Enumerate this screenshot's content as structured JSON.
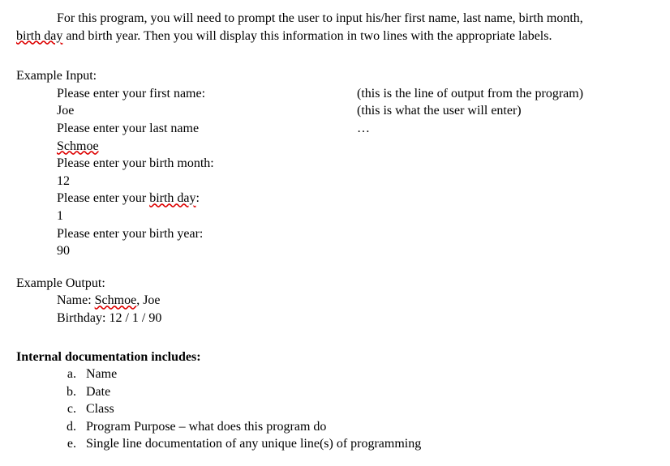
{
  "intro": {
    "line1_indent": "For this program, you will need to prompt the user to input his/her first name, last name, birth month,",
    "line2_prefix_squiggle": "birth day",
    "line2_rest": " and birth year.  Then you will display this information in two lines with the appropriate labels."
  },
  "example_input_header": "Example Input:",
  "input_rows": [
    {
      "left": "Please enter your first name:",
      "right": "(this is the line of output from the program)"
    },
    {
      "left": "Joe",
      "right": "(this is what the user will enter)"
    },
    {
      "left": "Please enter your last name",
      "right": "…"
    },
    {
      "left_squiggle": "Schmoe",
      "right": ""
    },
    {
      "left": "Please enter your birth month:",
      "right": ""
    },
    {
      "left": "12",
      "right": ""
    },
    {
      "left_mixed_pre": "Please enter your ",
      "left_mixed_squiggle": "birth day",
      "left_mixed_post": ":",
      "right": ""
    },
    {
      "left": "1",
      "right": ""
    },
    {
      "left": "Please enter your birth year:",
      "right": ""
    },
    {
      "left": "90",
      "right": ""
    }
  ],
  "example_output_header": "Example Output:",
  "output_lines": {
    "name_pre": "Name:  ",
    "name_squiggle": "Schmoe",
    "name_post": ", Joe",
    "birthday": "Birthday:  12 / 1 / 90"
  },
  "doc_header": "Internal documentation includes:",
  "doc_items": [
    {
      "letter": "a.",
      "text": "Name"
    },
    {
      "letter": "b.",
      "text": "Date"
    },
    {
      "letter": "c.",
      "text": "Class"
    },
    {
      "letter": "d.",
      "text": "Program Purpose – what does this program do"
    },
    {
      "letter": "e.",
      "text": "Single line documentation of any unique line(s) of programming"
    }
  ]
}
